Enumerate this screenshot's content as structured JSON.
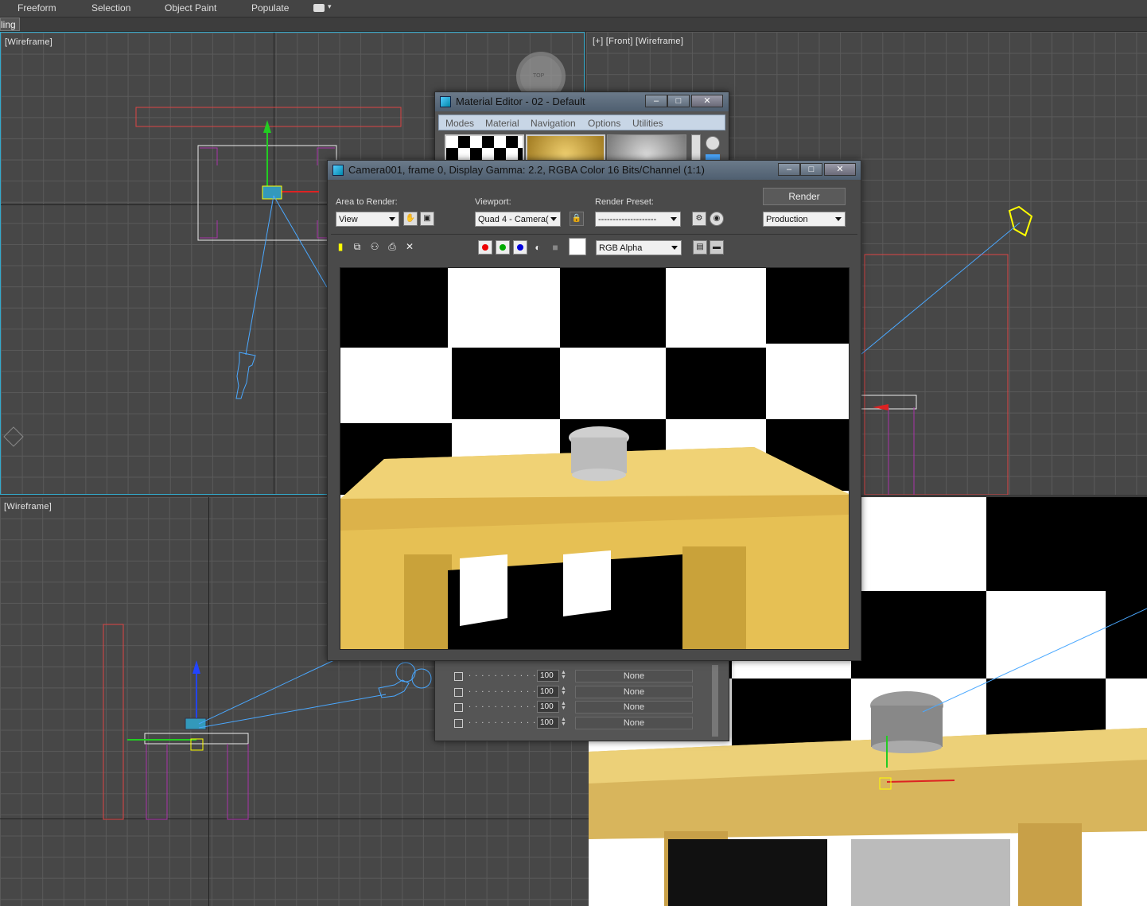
{
  "toolbar": {
    "tabs": [
      "Freeform",
      "Selection",
      "Object Paint",
      "Populate"
    ],
    "ribbon_label": "ling"
  },
  "viewports": {
    "top_left_label": "[Wireframe]",
    "top_right_label": "[+] [Front] [Wireframe]",
    "bottom_left_label": "[Wireframe]",
    "viewcube_text": "TOP"
  },
  "material_editor": {
    "title": "Material Editor - 02 - Default",
    "menus": [
      "Modes",
      "Material",
      "Navigation",
      "Options",
      "Utilities"
    ],
    "map_rows": [
      {
        "amount": "100",
        "map": "None"
      },
      {
        "amount": "100",
        "map": "None"
      },
      {
        "amount": "100",
        "map": "None"
      },
      {
        "amount": "100",
        "map": "None"
      }
    ]
  },
  "render_window": {
    "title": "Camera001, frame 0, Display Gamma: 2.2, RGBA Color 16 Bits/Channel (1:1)",
    "area_to_render_label": "Area to Render:",
    "area_to_render_value": "View",
    "viewport_label": "Viewport:",
    "viewport_value": "Quad 4 - Camera(",
    "render_preset_label": "Render Preset:",
    "render_preset_value": "--------------------",
    "render_button": "Render",
    "production_value": "Production",
    "channel_value": "RGB Alpha"
  },
  "colors": {
    "viewport_bg": "#474747",
    "titlebar": "#5f6f80",
    "wood": "#e0c060",
    "selection_blue": "#4aa8ff"
  }
}
